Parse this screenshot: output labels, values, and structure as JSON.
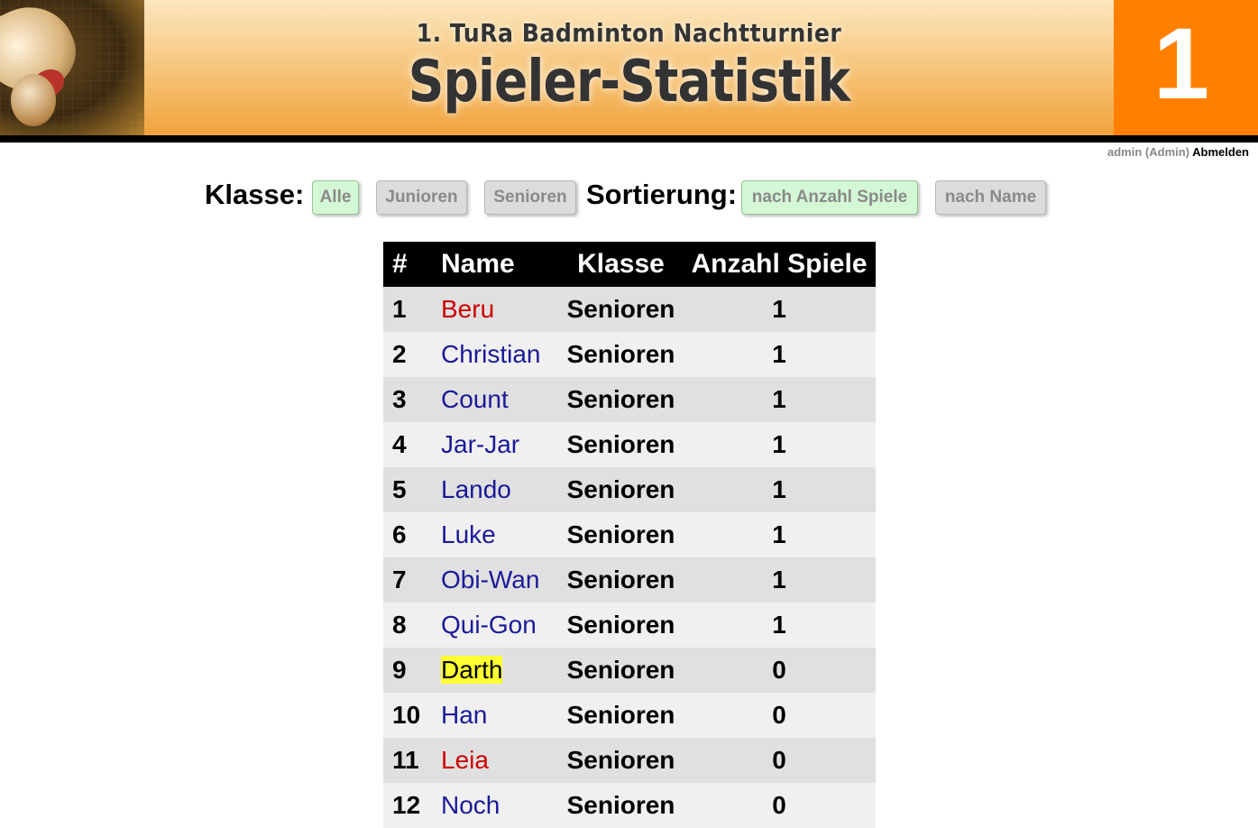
{
  "header": {
    "subtitle": "1. TuRa Badminton Nachtturnier",
    "title": "Spieler-Statistik",
    "round_number": "1",
    "accent_color": "#ff8000"
  },
  "userbar": {
    "user": "admin (Admin)",
    "logout_label": "Abmelden"
  },
  "filters": {
    "class_label": "Klasse:",
    "class_buttons": [
      {
        "label": "Alle",
        "active": true
      },
      {
        "label": "Junioren",
        "active": false
      },
      {
        "label": "Senioren",
        "active": false
      }
    ],
    "sort_label": "Sortierung:",
    "sort_buttons": [
      {
        "label": "nach Anzahl Spiele",
        "active": true
      },
      {
        "label": "nach Name",
        "active": false
      }
    ]
  },
  "table": {
    "columns": [
      "#",
      "Name",
      "Klasse",
      "Anzahl Spiele"
    ],
    "rows": [
      {
        "rank": "1",
        "name": "Beru",
        "klasse": "Senioren",
        "spiele": "1",
        "name_color": "red"
      },
      {
        "rank": "2",
        "name": "Christian",
        "klasse": "Senioren",
        "spiele": "1",
        "name_color": "blue"
      },
      {
        "rank": "3",
        "name": "Count",
        "klasse": "Senioren",
        "spiele": "1",
        "name_color": "blue"
      },
      {
        "rank": "4",
        "name": "Jar-Jar",
        "klasse": "Senioren",
        "spiele": "1",
        "name_color": "blue"
      },
      {
        "rank": "5",
        "name": "Lando",
        "klasse": "Senioren",
        "spiele": "1",
        "name_color": "blue"
      },
      {
        "rank": "6",
        "name": "Luke",
        "klasse": "Senioren",
        "spiele": "1",
        "name_color": "blue"
      },
      {
        "rank": "7",
        "name": "Obi-Wan",
        "klasse": "Senioren",
        "spiele": "1",
        "name_color": "blue"
      },
      {
        "rank": "8",
        "name": "Qui-Gon",
        "klasse": "Senioren",
        "spiele": "1",
        "name_color": "blue"
      },
      {
        "rank": "9",
        "name": "Darth",
        "klasse": "Senioren",
        "spiele": "0",
        "name_color": "highlight"
      },
      {
        "rank": "10",
        "name": "Han",
        "klasse": "Senioren",
        "spiele": "0",
        "name_color": "blue"
      },
      {
        "rank": "11",
        "name": "Leia",
        "klasse": "Senioren",
        "spiele": "0",
        "name_color": "red"
      },
      {
        "rank": "12",
        "name": "Noch",
        "klasse": "Senioren",
        "spiele": "0",
        "name_color": "blue"
      }
    ]
  }
}
